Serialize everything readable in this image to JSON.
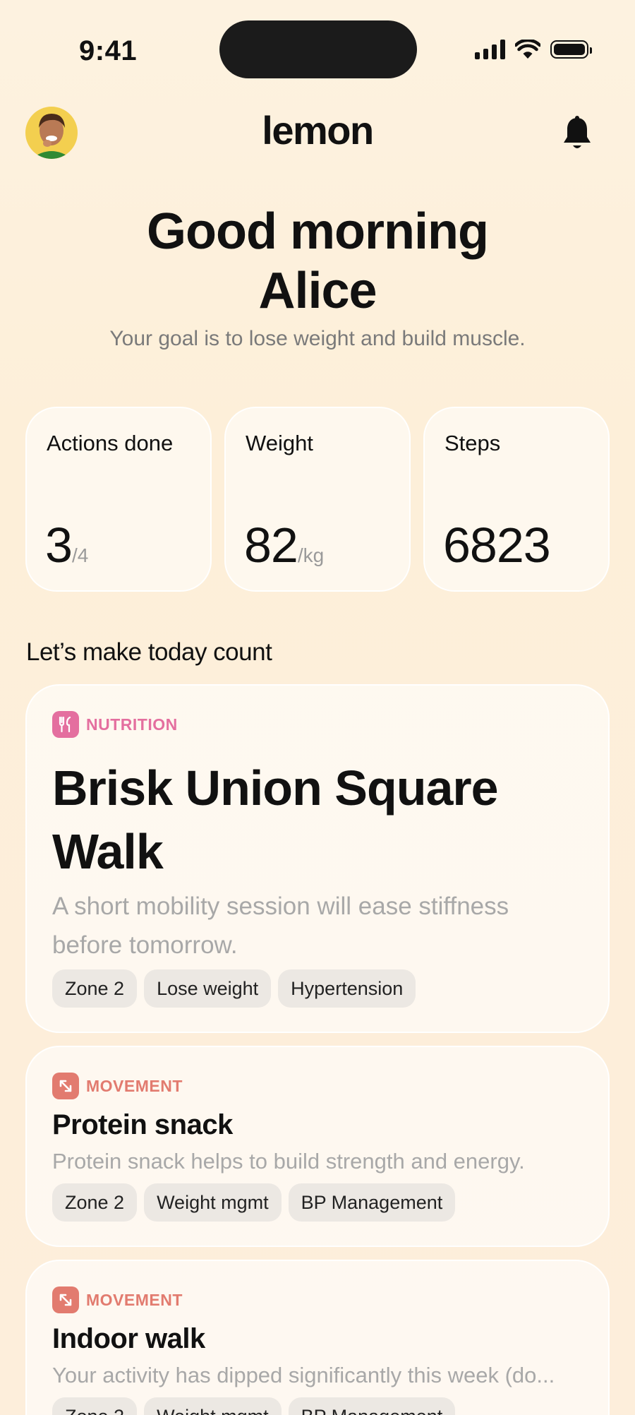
{
  "status_bar": {
    "time": "9:41"
  },
  "header": {
    "brand": "lemon"
  },
  "greeting": {
    "line1": "Good morning",
    "line2": "Alice",
    "goal": "Your goal is to lose weight and build muscle."
  },
  "stats": [
    {
      "label": "Actions done",
      "value": "3",
      "unit": "/4"
    },
    {
      "label": "Weight",
      "value": "82",
      "unit": "/kg"
    },
    {
      "label": "Steps",
      "value": "6823",
      "unit": ""
    }
  ],
  "section_title": "Let’s make today count",
  "cards": [
    {
      "category": "NUTRITION",
      "category_icon": "utensils-icon",
      "category_color": "#e46f9f",
      "title": "Brisk Union Square Walk",
      "description": "A short mobility session will ease stiffness before tomorrow.",
      "tags": [
        "Zone 2",
        "Lose weight",
        "Hypertension"
      ]
    },
    {
      "category": "MOVEMENT",
      "category_icon": "expand-arrows-icon",
      "category_color": "#e27b6f",
      "title": "Protein snack",
      "description": "Protein snack helps to build strength and energy.",
      "tags": [
        "Zone 2",
        "Weight mgmt",
        "BP Management"
      ]
    },
    {
      "category": "MOVEMENT",
      "category_icon": "expand-arrows-icon",
      "category_color": "#e27b6f",
      "title": "Indoor walk",
      "description": "Your activity has dipped significantly this week (do...",
      "tags": [
        "Zone 2",
        "Weight mgmt",
        "BP Management"
      ]
    }
  ]
}
